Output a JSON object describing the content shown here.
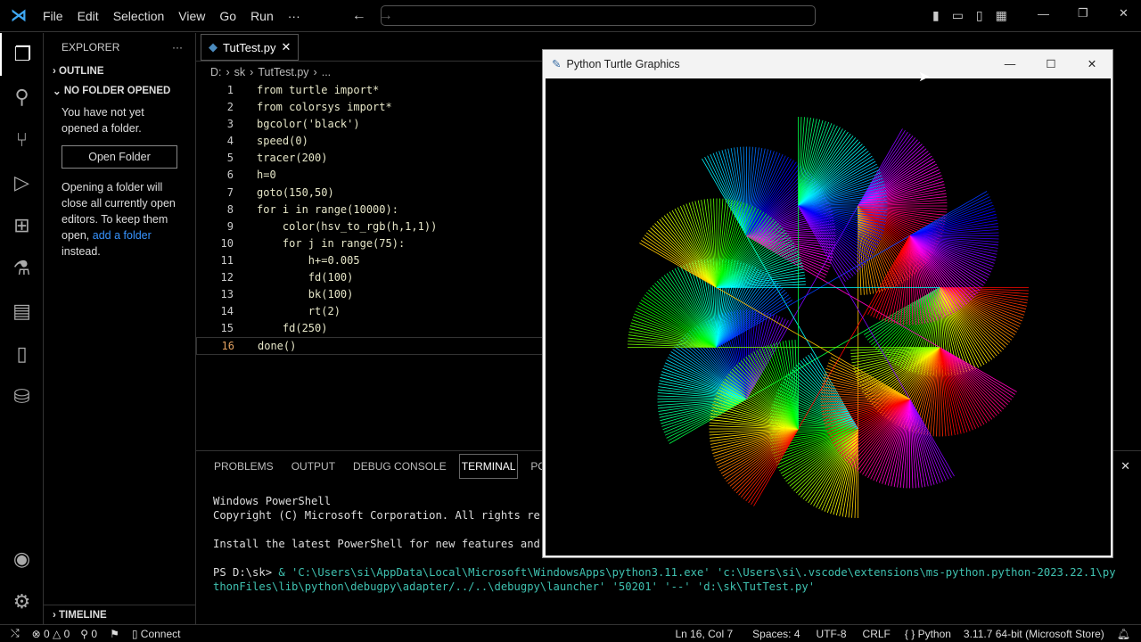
{
  "menu": [
    "File",
    "Edit",
    "Selection",
    "View",
    "Go",
    "Run",
    "···"
  ],
  "sidebar": {
    "title": "EXPLORER",
    "outline": "OUTLINE",
    "no_folder": "NO FOLDER OPENED",
    "msg1": "You have not yet opened a folder.",
    "open_btn": "Open Folder",
    "msg2a": "Opening a folder will close all currently open editors. To keep them open, ",
    "msg2link": "add a folder",
    "msg2b": " instead.",
    "timeline": "TIMELINE"
  },
  "tab": {
    "label": "TutTest.py"
  },
  "breadcrumb": [
    "D:",
    "sk",
    "TutTest.py",
    "..."
  ],
  "code": [
    "from turtle import*",
    "from colorsys import*",
    "bgcolor('black')",
    "speed(0)",
    "tracer(200)",
    "h=0",
    "goto(150,50)",
    "for i in range(10000):",
    "    color(hsv_to_rgb(h,1,1))",
    "    for j in range(75):",
    "        h+=0.005",
    "        fd(100)",
    "        bk(100)",
    "        rt(2)",
    "    fd(250)",
    "done()"
  ],
  "panel": {
    "tabs": [
      "PROBLEMS",
      "OUTPUT",
      "DEBUG CONSOLE",
      "TERMINAL",
      "PORTS"
    ],
    "active": "TERMINAL"
  },
  "terminal": {
    "l1": "Windows PowerShell",
    "l2": "Copyright (C) Microsoft Corporation. All rights re",
    "l3": "Install the latest PowerShell for new features and",
    "prompt": "PS D:\\sk> ",
    "cmd1": " & 'C:\\Users\\si\\AppData\\Local\\Microsoft\\WindowsApps\\python3.11.exe' 'c:\\Users\\si\\.vscode\\extensions\\ms-python.python-2023.22.1\\py",
    "cmd2": "thonFiles\\lib\\python\\debugpy\\adapter/../..\\debugpy\\launcher' '50201' '--' 'd:\\sk\\TutTest.py'"
  },
  "status": {
    "errors": "0",
    "warnings": "0",
    "ports": "0",
    "connect": "Connect",
    "position": "Ln 16, Col 7",
    "spaces": "Spaces: 4",
    "encoding": "UTF-8",
    "eol": "CRLF",
    "language": "Python",
    "interpreter": "3.11.7 64-bit (Microsoft Store)"
  },
  "turtle_window": {
    "title": "Python Turtle Graphics",
    "fans": 12,
    "hue_step": 0.375,
    "fan_lines": 75,
    "fan_length": 100,
    "turn": 2,
    "step": 250
  }
}
